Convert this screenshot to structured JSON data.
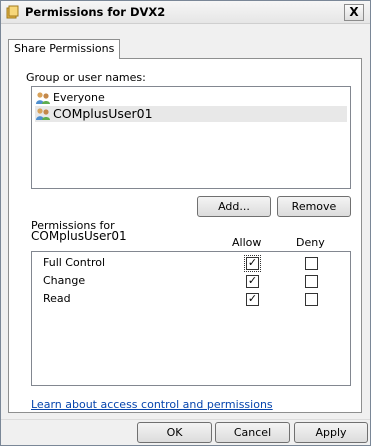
{
  "window": {
    "title": "Permissions for DVX2",
    "close_label": "X"
  },
  "tabs": [
    {
      "label": "Share Permissions",
      "selected": true
    }
  ],
  "group_section": {
    "label": "Group or user names:",
    "users": [
      {
        "name": "Everyone",
        "icon": "user-group-icon",
        "selected": false
      },
      {
        "name": "COMplusUser01",
        "icon": "user-group-icon",
        "selected": true
      }
    ],
    "add_button": "Add...",
    "remove_button": "Remove"
  },
  "permissions": {
    "for_label": "Permissions for",
    "for_user": "COMplusUser01",
    "allow_header": "Allow",
    "deny_header": "Deny",
    "rows": [
      {
        "name": "Full Control",
        "allow": true,
        "deny": false
      },
      {
        "name": "Change",
        "allow": true,
        "deny": false
      },
      {
        "name": "Read",
        "allow": true,
        "deny": false
      }
    ]
  },
  "help_link": "Learn about access control and permissions",
  "footer": {
    "ok": "OK",
    "cancel": "Cancel",
    "apply": "Apply"
  },
  "checkmark": "✓",
  "colors": {
    "link": "#0645ad",
    "selection": "#e8e8e8",
    "border": "#828790"
  }
}
